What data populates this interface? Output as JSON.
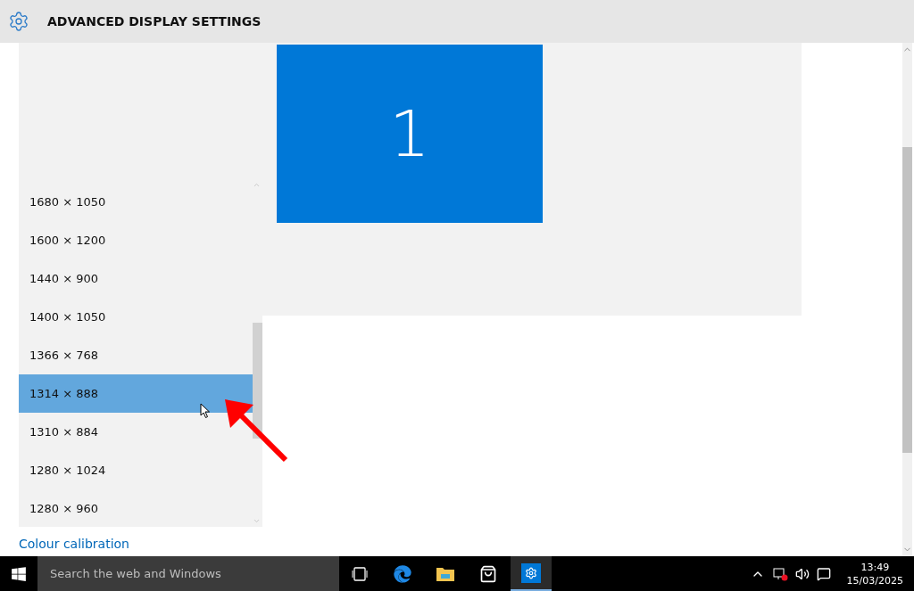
{
  "header": {
    "title": "ADVANCED DISPLAY SETTINGS"
  },
  "preview": {
    "monitor_label": "1"
  },
  "resolution_list": {
    "items": [
      {
        "label": "1680 × 1050",
        "selected": false
      },
      {
        "label": "1600 × 1200",
        "selected": false
      },
      {
        "label": "1440 × 900",
        "selected": false
      },
      {
        "label": "1400 × 1050",
        "selected": false
      },
      {
        "label": "1366 × 768",
        "selected": false
      },
      {
        "label": "1314 × 888",
        "selected": true
      },
      {
        "label": "1310 × 884",
        "selected": false
      },
      {
        "label": "1280 × 1024",
        "selected": false
      },
      {
        "label": "1280 × 960",
        "selected": false
      }
    ]
  },
  "link": "Colour calibration",
  "taskbar": {
    "search_placeholder": "Search the web and Windows",
    "clock_time": "13:49",
    "clock_date": "15/03/2025"
  }
}
